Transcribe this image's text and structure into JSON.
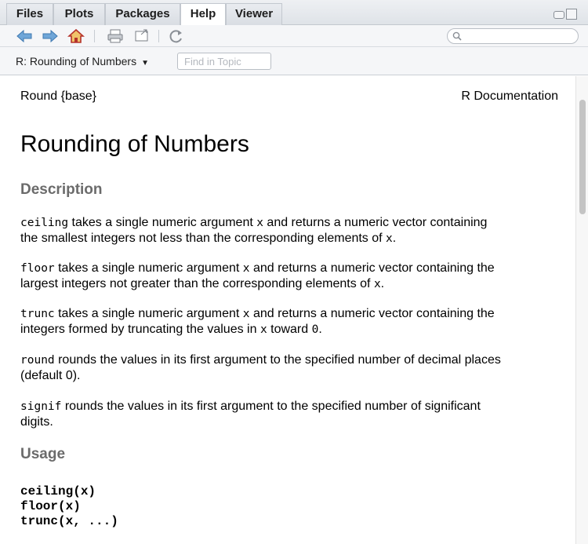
{
  "tabs": [
    {
      "label": "Files",
      "active": false
    },
    {
      "label": "Plots",
      "active": false
    },
    {
      "label": "Packages",
      "active": false
    },
    {
      "label": "Help",
      "active": true
    },
    {
      "label": "Viewer",
      "active": false
    }
  ],
  "toolbar": {
    "icons": [
      "back-icon",
      "forward-icon",
      "home-icon",
      "print-icon",
      "open-in-window-icon",
      "refresh-icon"
    ],
    "search_value": ""
  },
  "topicbar": {
    "topic": "R: Rounding of Numbers",
    "find_placeholder": "Find in Topic"
  },
  "doc": {
    "header_left": "Round {base}",
    "header_right": "R Documentation",
    "title": "Rounding of Numbers",
    "description_heading": "Description",
    "p1": {
      "code": "ceiling",
      "text1": " takes a single numeric argument ",
      "x1": "x",
      "text2": " and returns a numeric vector containing",
      "line2": "the smallest integers not less than the corresponding elements of ",
      "x2": "x",
      "end": "."
    },
    "p2": {
      "code": "floor",
      "text1": " takes a single numeric argument ",
      "x1": "x",
      "text2": " and returns a numeric vector containing the",
      "line2": "largest integers not greater than the corresponding elements of ",
      "x2": "x",
      "end": "."
    },
    "p3": {
      "code": "trunc",
      "text1": " takes a single numeric argument ",
      "x1": "x",
      "text2": " and returns a numeric vector containing the",
      "line2": "integers formed by truncating the values in ",
      "x2": "x",
      "mid": " toward ",
      "zero": "0",
      "end": "."
    },
    "p4": {
      "code": "round",
      "text1": " rounds the values in its first argument to the specified number of decimal places",
      "line2": "(default 0)."
    },
    "p5": {
      "code": "signif",
      "text1": " rounds the values in its first argument to the specified number of significant",
      "line2": "digits."
    },
    "usage_heading": "Usage",
    "usage_lines": [
      "ceiling(x)",
      "floor(x)",
      "trunc(x, ...)"
    ]
  }
}
